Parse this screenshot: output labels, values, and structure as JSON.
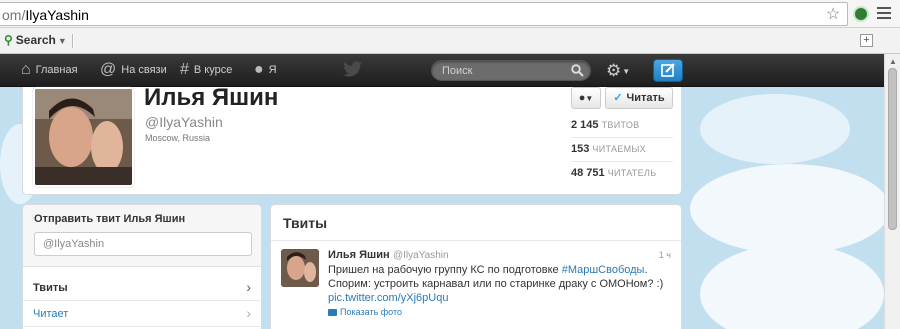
{
  "browser": {
    "url_dim": "om/",
    "url_main": "IlyaYashin",
    "bookmarks_search_label": "Search"
  },
  "nav": {
    "home": "Главная",
    "connect": "На связи",
    "discover": "В курсе",
    "me": "Я",
    "search_placeholder": "Поиск"
  },
  "profile": {
    "name": "Илья Яшин",
    "screen_name": "@IlyaYashin",
    "location": "Moscow, Russia",
    "follow_label": "Читать",
    "stats": [
      {
        "value": "2 145",
        "label": "ТВИТОВ"
      },
      {
        "value": "153",
        "label": "ЧИТАЕМЫХ"
      },
      {
        "value": "48 751",
        "label": "ЧИТАТЕЛЬ"
      }
    ]
  },
  "sidebar": {
    "compose_title": "Отправить твит Илья Яшин",
    "compose_value": "@IlyaYashin",
    "items": [
      {
        "label": "Твиты"
      },
      {
        "label": "Читает"
      }
    ]
  },
  "timeline": {
    "title": "Твиты",
    "tweet": {
      "name": "Илья Яшин",
      "screen_name": "@IlyaYashin",
      "time": "1 ч",
      "text_before": "Пришел на рабочую группу КС по подготовке ",
      "hashtag": "#МаршСвободы",
      "text_after": ". Спорим: устроить карнавал или по старинке драку с ОМОНом? :) ",
      "link": "pic.twitter.com/yXj6pUqu",
      "show_photo": "Показать фото"
    }
  },
  "colors": {
    "link": "#2a7ab8",
    "follow_bird": "#2aa3ef",
    "compose_button": "#1f80c6"
  }
}
